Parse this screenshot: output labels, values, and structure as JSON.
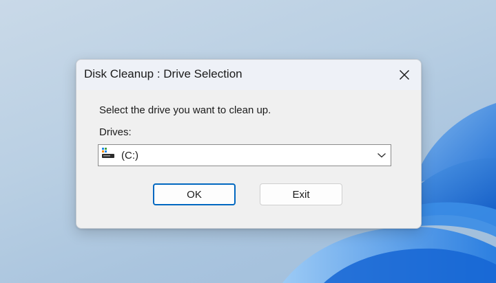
{
  "dialog": {
    "title": "Disk Cleanup : Drive Selection",
    "prompt": "Select the drive you want to clean up.",
    "drives_label": "Drives:",
    "selected_drive": "(C:)",
    "ok_label": "OK",
    "exit_label": "Exit"
  },
  "icons": {
    "close": "close-icon",
    "drive": "drive-icon",
    "dropdown": "chevron-down-icon"
  },
  "colors": {
    "accent": "#0067c0",
    "dialog_bg": "#f0f0f0",
    "titlebar_bg": "#eef1f7"
  }
}
